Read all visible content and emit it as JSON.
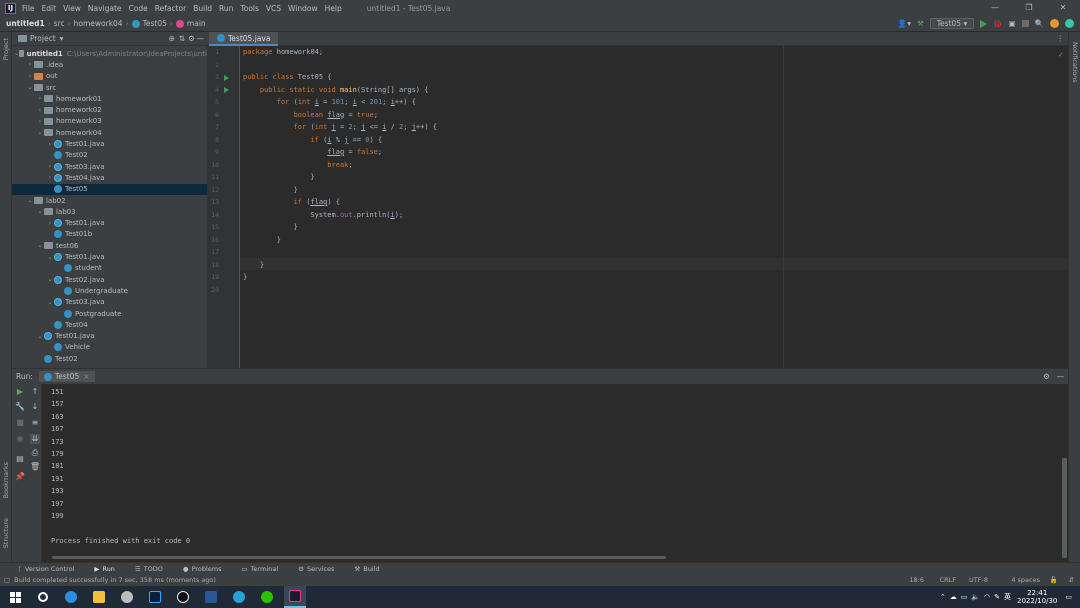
{
  "menu": {
    "items": [
      "File",
      "Edit",
      "View",
      "Navigate",
      "Code",
      "Refactor",
      "Build",
      "Run",
      "Tools",
      "VCS",
      "Window",
      "Help"
    ],
    "window_title": "untitled1 - Test05.java"
  },
  "breadcrumb": [
    "untitled1",
    "src",
    "homework04",
    "Test05",
    "main"
  ],
  "run_config": "Test05",
  "project_panel": {
    "title": "Project",
    "root": "untitled1",
    "root_path": "C:\\Users\\Administrator\\IdeaProjects\\unti",
    "tree": [
      {
        "label": "untitled1",
        "indent": 0,
        "arrow": "v",
        "icon": "folder"
      },
      {
        "label": ".idea",
        "indent": 1,
        "arrow": ">",
        "icon": "folder"
      },
      {
        "label": "out",
        "indent": 1,
        "arrow": ">",
        "icon": "folder-orange"
      },
      {
        "label": "src",
        "indent": 1,
        "arrow": "v",
        "icon": "folder"
      },
      {
        "label": "homework01",
        "indent": 2,
        "arrow": ">",
        "icon": "folder"
      },
      {
        "label": "homework02",
        "indent": 2,
        "arrow": ">",
        "icon": "folder"
      },
      {
        "label": "homework03",
        "indent": 2,
        "arrow": ">",
        "icon": "folder"
      },
      {
        "label": "homework04",
        "indent": 2,
        "arrow": "v",
        "icon": "folder"
      },
      {
        "label": "Test01.java",
        "indent": 3,
        "arrow": ">",
        "icon": "java"
      },
      {
        "label": "Test02",
        "indent": 3,
        "arrow": "",
        "icon": "class"
      },
      {
        "label": "Test03.java",
        "indent": 3,
        "arrow": ">",
        "icon": "java"
      },
      {
        "label": "Test04.java",
        "indent": 3,
        "arrow": ">",
        "icon": "java"
      },
      {
        "label": "Test05",
        "indent": 3,
        "arrow": "",
        "icon": "class",
        "selected": true
      },
      {
        "label": "lab02",
        "indent": 1,
        "arrow": "v",
        "icon": "folder"
      },
      {
        "label": "lab03",
        "indent": 2,
        "arrow": "v",
        "icon": "folder"
      },
      {
        "label": "Test01.java",
        "indent": 3,
        "arrow": ">",
        "icon": "java"
      },
      {
        "label": "Test01b",
        "indent": 3,
        "arrow": "",
        "icon": "class"
      },
      {
        "label": "test06",
        "indent": 2,
        "arrow": "v",
        "icon": "folder"
      },
      {
        "label": "Test01.java",
        "indent": 3,
        "arrow": "v",
        "icon": "java"
      },
      {
        "label": "student",
        "indent": 4,
        "arrow": "",
        "icon": "class"
      },
      {
        "label": "Test02.java",
        "indent": 3,
        "arrow": "v",
        "icon": "java"
      },
      {
        "label": "Undergraduate",
        "indent": 4,
        "arrow": "",
        "icon": "class"
      },
      {
        "label": "Test03.java",
        "indent": 3,
        "arrow": "v",
        "icon": "java"
      },
      {
        "label": "Postgraduate",
        "indent": 4,
        "arrow": "",
        "icon": "class"
      },
      {
        "label": "Test04",
        "indent": 3,
        "arrow": "",
        "icon": "class"
      },
      {
        "label": "Test01.java",
        "indent": 2,
        "arrow": "v",
        "icon": "java"
      },
      {
        "label": "Vehicle",
        "indent": 3,
        "arrow": "",
        "icon": "class"
      },
      {
        "label": "Test02",
        "indent": 2,
        "arrow": "",
        "icon": "class"
      }
    ]
  },
  "editor": {
    "tab": "Test05.java",
    "lines": [
      {
        "n": "1",
        "html": "<span class='kw'>package</span> homework04;"
      },
      {
        "n": "2",
        "html": ""
      },
      {
        "n": "3",
        "html": "<span class='kw'>public class</span> Test05 {"
      },
      {
        "n": "4",
        "html": "    <span class='kw'>public static void</span> <span class='fn'>main</span>(String[] args) {"
      },
      {
        "n": "5",
        "html": "        <span class='kw'>for</span> (<span class='kw'>int</span> <u>i</u> = <span class='num'>101</span>; <u>i</u> &lt; <span class='num'>201</span>; <u>i</u>++) {"
      },
      {
        "n": "6",
        "html": "            <span class='kw'>boolean</span> <u>flag</u> = <span class='kw'>true</span>;"
      },
      {
        "n": "7",
        "html": "            <span class='kw'>for</span> (<span class='kw'>int</span> <u>j</u> = <span class='num'>2</span>; <u>j</u> &lt;= <u>i</u> / <span class='num'>2</span>; <u>j</u>++) {"
      },
      {
        "n": "8",
        "html": "                <span class='kw'>if</span> (<u>i</u> % <u>j</u> == <span class='num'>0</span>) {"
      },
      {
        "n": "9",
        "html": "                    <u>flag</u> = <span class='kw'>false</span>;"
      },
      {
        "n": "10",
        "html": "                    <span class='kw'>break</span>;"
      },
      {
        "n": "11",
        "html": "                }"
      },
      {
        "n": "12",
        "html": "            }"
      },
      {
        "n": "13",
        "html": "            <span class='kw'>if</span> (<u>flag</u>) {"
      },
      {
        "n": "14",
        "html": "                System.<span class='pur'>out</span>.println(<u>i</u>);"
      },
      {
        "n": "15",
        "html": "            }"
      },
      {
        "n": "16",
        "html": "        }"
      },
      {
        "n": "17",
        "html": ""
      },
      {
        "n": "18",
        "html": "    }"
      },
      {
        "n": "19",
        "html": "}"
      },
      {
        "n": "20",
        "html": ""
      }
    ]
  },
  "run_panel": {
    "label": "Run:",
    "tab": "Test05",
    "output": [
      "151",
      "157",
      "163",
      "167",
      "173",
      "179",
      "181",
      "191",
      "193",
      "197",
      "199",
      "",
      "Process finished with exit code 0"
    ]
  },
  "tool_windows": [
    "Version Control",
    "Run",
    "TODO",
    "Problems",
    "Terminal",
    "Services",
    "Build"
  ],
  "left_strip": [
    "Project",
    "Bookmarks",
    "Structure"
  ],
  "right_strip": [
    "Notifications"
  ],
  "status": {
    "message": "Build completed successfully in 7 sec, 358 ms (moments ago)",
    "position": "18:6",
    "line_sep": "CRLF",
    "encoding": "UTF-8",
    "indent": "4 spaces"
  },
  "taskbar": {
    "time": "22:41",
    "date": "2022/10/30",
    "ime": "英"
  }
}
